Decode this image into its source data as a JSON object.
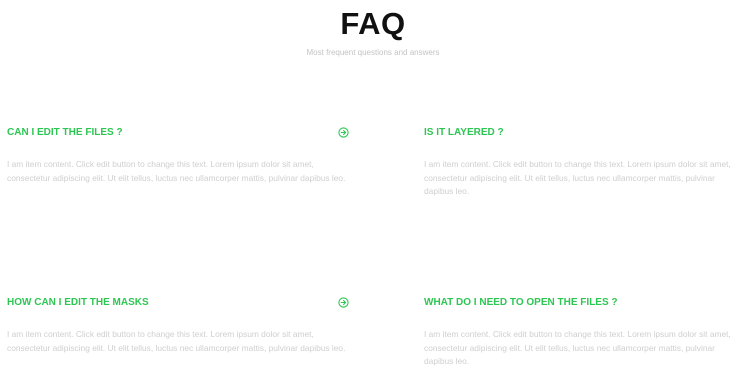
{
  "header": {
    "title": "FAQ",
    "subtitle": "Most frequent questions and answers"
  },
  "faq": [
    {
      "question": "CAN I EDIT THE FILES ?",
      "answer": "I am item content. Click edit button to change this text. Lorem ipsum dolor sit amet, consectetur adipiscing elit. Ut elit tellus, luctus nec ullamcorper mattis, pulvinar dapibus leo.",
      "icon": "arrow-circle-right-icon"
    },
    {
      "question": "IS IT LAYERED ?",
      "answer": "I am item content. Click edit button to change this text. Lorem ipsum dolor sit amet, consectetur adipiscing elit. Ut elit tellus, luctus nec ullamcorper mattis, pulvinar dapibus leo."
    },
    {
      "question": "HOW CAN I EDIT THE MASKS",
      "answer": "I am item content. Click edit button to change this text. Lorem ipsum dolor sit amet, consectetur adipiscing elit. Ut elit tellus, luctus nec ullamcorper mattis, pulvinar dapibus leo.",
      "icon": "arrow-circle-right-icon"
    },
    {
      "question": "WHAT DO I NEED TO OPEN THE FILES ?",
      "answer": "I am item content. Click edit button to change this text. Lorem ipsum dolor sit amet, consectetur adipiscing elit. Ut elit tellus, luctus nec ullamcorper mattis, pulvinar dapibus leo."
    }
  ],
  "colors": {
    "accent": "#2dc653",
    "title": "#111111",
    "muted_text": "#cfcfcf",
    "background": "#ffffff"
  }
}
